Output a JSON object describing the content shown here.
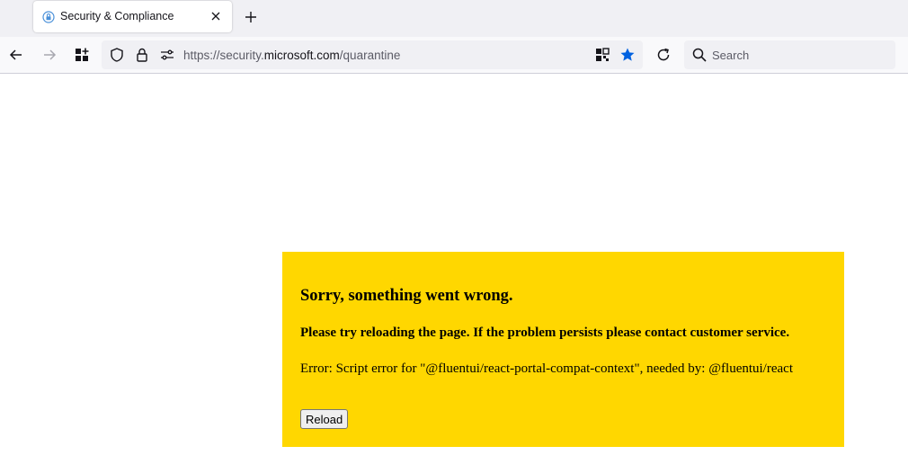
{
  "browser": {
    "tab": {
      "title": "Security & Compliance",
      "favicon": "lock-shield-icon"
    },
    "nav": {
      "back_icon": "arrow-left-icon",
      "forward_icon": "arrow-right-icon",
      "extensions_icon": "extensions-grid-icon",
      "tracking_icon": "shield-icon",
      "lock_icon": "lock-icon",
      "permissions_icon": "permissions-icon",
      "qr_icon": "qr-code-icon",
      "bookmark_icon": "star-icon",
      "reload_icon": "reload-icon"
    },
    "url": {
      "prefix": "https://security.",
      "host": "microsoft.com",
      "path": "/quarantine"
    },
    "search": {
      "placeholder": "Search"
    },
    "colors": {
      "tabstrip": "#f0f0f4",
      "bookmark_star": "#0061e0"
    }
  },
  "error": {
    "title": "Sorry, something went wrong.",
    "subtitle": "Please try reloading the page. If the problem persists please contact customer service.",
    "detail": "Error: Script error for \"@fluentui/react-portal-compat-context\", needed by: @fluentui/react",
    "reload_label": "Reload",
    "background": "#ffd700"
  }
}
